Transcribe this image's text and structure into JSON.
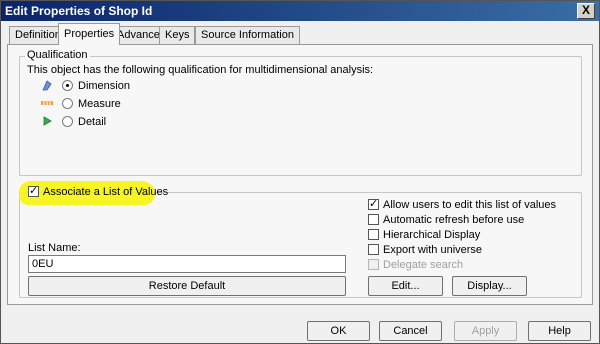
{
  "window": {
    "title": "Edit Properties of Shop Id",
    "close_glyph": "X"
  },
  "tabs": [
    "Definition",
    "Properties",
    "Advanced",
    "Keys",
    "Source Information"
  ],
  "active_tab": "Properties",
  "qualification": {
    "legend": "Qualification",
    "description": "This object has the following qualification for multidimensional analysis:",
    "options": [
      {
        "label": "Dimension",
        "icon": "dimension-icon",
        "selected": true
      },
      {
        "label": "Measure",
        "icon": "measure-icon",
        "selected": false
      },
      {
        "label": "Detail",
        "icon": "detail-icon",
        "selected": false
      }
    ]
  },
  "lov": {
    "associate_label": "Associate a List of Values",
    "associate_checked": true,
    "list_name_label": "List Name:",
    "list_name_value": "0EU",
    "restore_default": "Restore Default",
    "options": [
      {
        "label": "Allow users to edit this list of values",
        "checked": true,
        "enabled": true
      },
      {
        "label": "Automatic refresh before use",
        "checked": false,
        "enabled": true
      },
      {
        "label": "Hierarchical Display",
        "checked": false,
        "enabled": true
      },
      {
        "label": "Export with universe",
        "checked": false,
        "enabled": true
      },
      {
        "label": "Delegate search",
        "checked": false,
        "enabled": false
      }
    ],
    "edit_button": "Edit...",
    "display_button": "Display..."
  },
  "footer": {
    "ok": "OK",
    "cancel": "Cancel",
    "apply": "Apply",
    "help": "Help"
  },
  "colors": {
    "highlight": "#f8f400",
    "title_bar": "#0a246a"
  }
}
